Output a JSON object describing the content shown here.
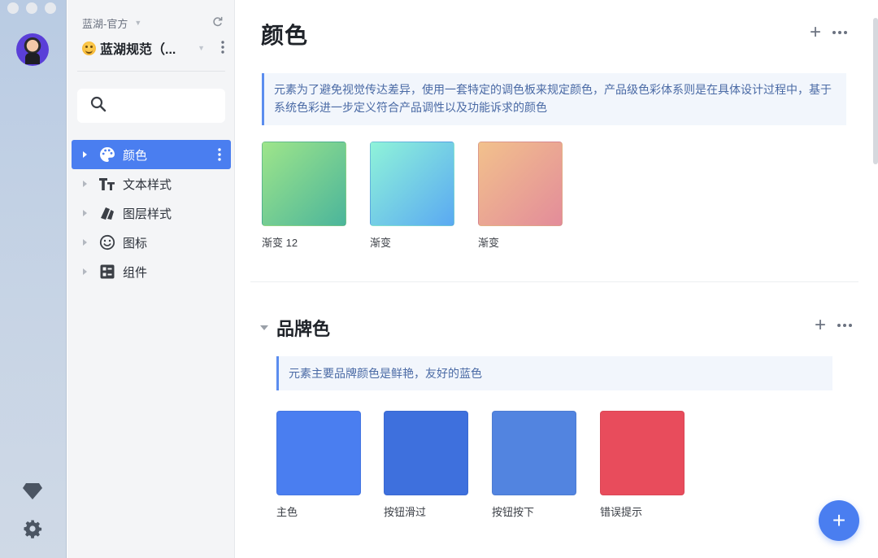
{
  "app": {
    "team_name": "蓝湖-官方",
    "project_name": "蓝湖规范（...",
    "search": {
      "value": "",
      "placeholder": ""
    }
  },
  "sidebar": {
    "items": [
      {
        "label": "颜色",
        "icon": "palette-icon",
        "active": true
      },
      {
        "label": "文本样式",
        "icon": "text-style-icon",
        "active": false
      },
      {
        "label": "图层样式",
        "icon": "layer-style-icon",
        "active": false
      },
      {
        "label": "图标",
        "icon": "smiley-icon",
        "active": false
      },
      {
        "label": "组件",
        "icon": "component-icon",
        "active": false
      }
    ]
  },
  "main": {
    "title": "颜色",
    "description": "元素为了避免视觉传达差异，使用一套特定的调色板来规定颜色，产品级色彩体系则是在具体设计过程中，基于系统色彩进一步定义符合产品调性以及功能诉求的颜色",
    "gradients": [
      {
        "label": "渐变 12",
        "from": "#9ee58a",
        "to": "#4bb59b"
      },
      {
        "label": "渐变",
        "from": "#8ff3d9",
        "to": "#5aa9f2"
      },
      {
        "label": "渐变",
        "from": "#f2c18c",
        "to": "#e38c9a"
      }
    ],
    "brand_section": {
      "title": "品牌色",
      "description": "元素主要品牌颜色是鲜艳，友好的蓝色",
      "swatches": [
        {
          "label": "主色",
          "color": "#4a7ef0"
        },
        {
          "label": "按钮滑过",
          "color": "#3e70dd"
        },
        {
          "label": "按钮按下",
          "color": "#5284e0"
        },
        {
          "label": "错误提示",
          "color": "#e84c5c"
        }
      ]
    }
  },
  "colors": {
    "accent": "#4a7ef0",
    "sidebar_bg": "#f4f5f7",
    "rail_bg": "#c3d1e4"
  }
}
